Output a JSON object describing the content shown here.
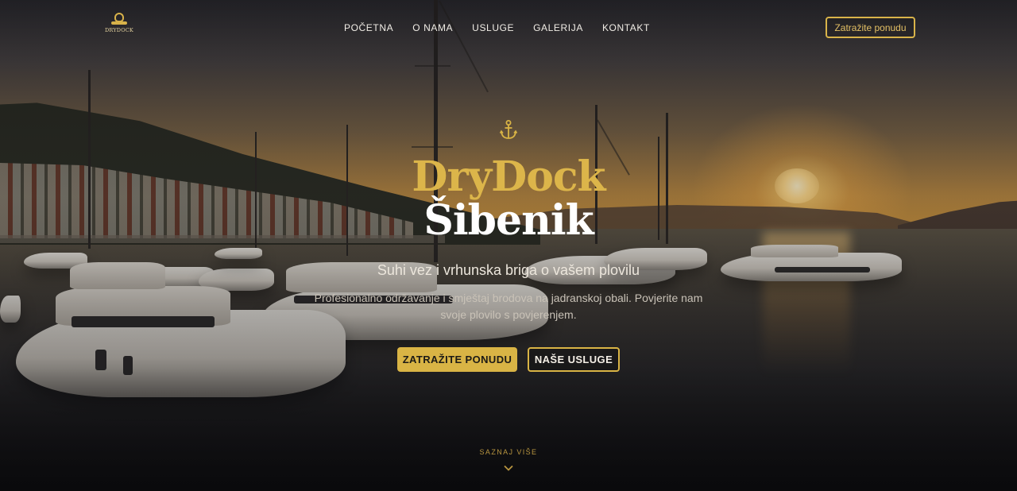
{
  "logo": {
    "text": "DRYDOCK"
  },
  "nav": {
    "items": [
      {
        "label": "POČETNA"
      },
      {
        "label": "O NAMA"
      },
      {
        "label": "USLUGE"
      },
      {
        "label": "GALERIJA"
      },
      {
        "label": "KONTAKT"
      }
    ],
    "cta_label": "Zatražite ponudu"
  },
  "hero": {
    "icon": "anchor-icon",
    "title_line1": "DryDock",
    "title_line2": "Šibenik",
    "subtitle": "Suhi vez i vrhunska briga o vašem plovilu",
    "description": "Profesionalno održavanje i smještaj brodova na jadranskoj obali. Povjerite nam svoje plovilo s povjerenjem.",
    "primary_button": "ZATRAŽITE PONUDU",
    "secondary_button": "NAŠE USLUGE"
  },
  "scroll": {
    "label": "SAZNAJ VIŠE",
    "icon": "chevron-down-icon"
  },
  "colors": {
    "accent": "#d9b445",
    "text": "#ffffff"
  }
}
